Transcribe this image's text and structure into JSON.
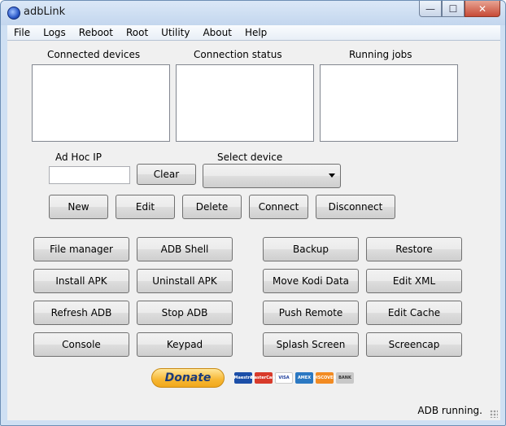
{
  "window": {
    "title": "adbLink",
    "min_glyph": "—",
    "max_glyph": "☐",
    "close_glyph": "✕"
  },
  "menu": [
    "File",
    "Logs",
    "Reboot",
    "Root",
    "Utility",
    "About",
    "Help"
  ],
  "panels": {
    "connected_devices": "Connected devices",
    "connection_status": "Connection status",
    "running_jobs": "Running jobs"
  },
  "adhoc": {
    "label": "Ad Hoc IP",
    "value": "",
    "clear": "Clear"
  },
  "device_select": {
    "label": "Select device",
    "selected": ""
  },
  "device_buttons": [
    "New",
    "Edit",
    "Delete",
    "Connect",
    "Disconnect"
  ],
  "tools_left": [
    [
      "File manager",
      "ADB Shell"
    ],
    [
      "Install APK",
      "Uninstall APK"
    ],
    [
      "Refresh ADB",
      "Stop ADB"
    ],
    [
      "Console",
      "Keypad"
    ]
  ],
  "tools_right": [
    [
      "Backup",
      "Restore"
    ],
    [
      "Move Kodi Data",
      "Edit XML"
    ],
    [
      "Push Remote",
      "Edit Cache"
    ],
    [
      "Splash Screen",
      "Screencap"
    ]
  ],
  "donate": {
    "label": "Donate"
  },
  "cards": [
    {
      "label": "Maestro",
      "color": "#1c4fa8"
    },
    {
      "label": "MasterCard",
      "color": "#d83a2a"
    },
    {
      "label": "VISA",
      "color": "#ffffff"
    },
    {
      "label": "AMEX",
      "color": "#2b78c2"
    },
    {
      "label": "DISCOVER",
      "color": "#f28b22"
    },
    {
      "label": "BANK",
      "color": "#c8c8c8"
    }
  ],
  "status": {
    "text": "ADB running."
  }
}
